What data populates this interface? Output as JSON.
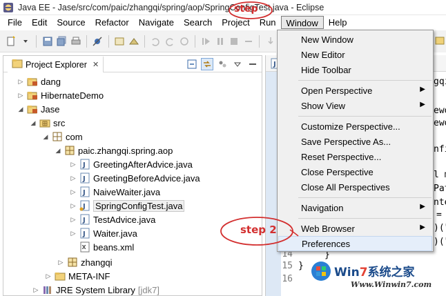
{
  "window": {
    "title": "Java EE - Jase/src/com/paic/zhangqi/spring/aop/SpringConfigTest.java - Eclipse"
  },
  "menubar": {
    "items": [
      {
        "label": "File"
      },
      {
        "label": "Edit"
      },
      {
        "label": "Source"
      },
      {
        "label": "Refactor"
      },
      {
        "label": "Navigate"
      },
      {
        "label": "Search"
      },
      {
        "label": "Project"
      },
      {
        "label": "Run"
      },
      {
        "label": "Window"
      },
      {
        "label": "Help"
      }
    ],
    "open_menu": "Window"
  },
  "window_menu": {
    "items": [
      {
        "label": "New Window"
      },
      {
        "label": "New Editor"
      },
      {
        "label": "Hide Toolbar"
      },
      {
        "label": "Open Perspective"
      },
      {
        "label": "Show View"
      },
      {
        "label": "Customize Perspective..."
      },
      {
        "label": "Save Perspective As..."
      },
      {
        "label": "Reset Perspective..."
      },
      {
        "label": "Close Perspective"
      },
      {
        "label": "Close All Perspectives"
      },
      {
        "label": "Navigation"
      },
      {
        "label": "Web Browser"
      },
      {
        "label": "Preferences"
      }
    ],
    "submenu_arrow": "▶",
    "highlighted": "Preferences"
  },
  "project_explorer": {
    "tab_label": "Project Explorer",
    "close_glyph": "✕",
    "tree": [
      {
        "label": "dang",
        "icon": "project-icon"
      },
      {
        "label": "HibernateDemo",
        "icon": "project-icon"
      },
      {
        "label": "Jase",
        "icon": "project-icon"
      },
      {
        "label": "src",
        "icon": "source-folder-icon"
      },
      {
        "label": "com",
        "icon": "package-icon"
      },
      {
        "label": "paic.zhangqi.spring.aop",
        "icon": "package-icon"
      },
      {
        "label": "GreetingAfterAdvice.java",
        "icon": "java-file-icon"
      },
      {
        "label": "GreetingBeforeAdvice.java",
        "icon": "java-file-icon"
      },
      {
        "label": "NaiveWaiter.java",
        "icon": "java-file-icon"
      },
      {
        "label": "SpringConfigTest.java",
        "icon": "java-file-icon"
      },
      {
        "label": "TestAdvice.java",
        "icon": "java-file-icon"
      },
      {
        "label": "Waiter.java",
        "icon": "java-file-icon"
      },
      {
        "label": "beans.xml",
        "icon": "xml-file-icon"
      },
      {
        "label": "zhangqi",
        "icon": "package-icon"
      },
      {
        "label": "META-INF",
        "icon": "folder-icon"
      },
      {
        "label": "JRE System Library",
        "icon": "library-icon",
        "decoration": "[jdk7]"
      }
    ]
  },
  "editor": {
    "line_numbers": [
      "14",
      "15",
      "16"
    ],
    "code_fragments": [
      {
        "text": "gqi"
      },
      {
        "text": "ewo"
      },
      {
        "text": "ewo"
      },
      {
        "text": "nfi"
      },
      {
        "text": "l m"
      },
      {
        "text": "Pat"
      },
      {
        "text": "nte"
      },
      {
        "text": "="
      },
      {
        "text": ")(\""
      },
      {
        "text": ")(\""
      },
      {
        "text": "}"
      },
      {
        "text": "}"
      }
    ]
  },
  "annotations": {
    "step1": "step",
    "step2": "step 2",
    "color": "#d32f2f"
  },
  "watermark": {
    "brand_prefix": "Win",
    "brand_digit": "7",
    "brand_suffix": "系统之家",
    "url": "Www.Winwin7.com"
  }
}
